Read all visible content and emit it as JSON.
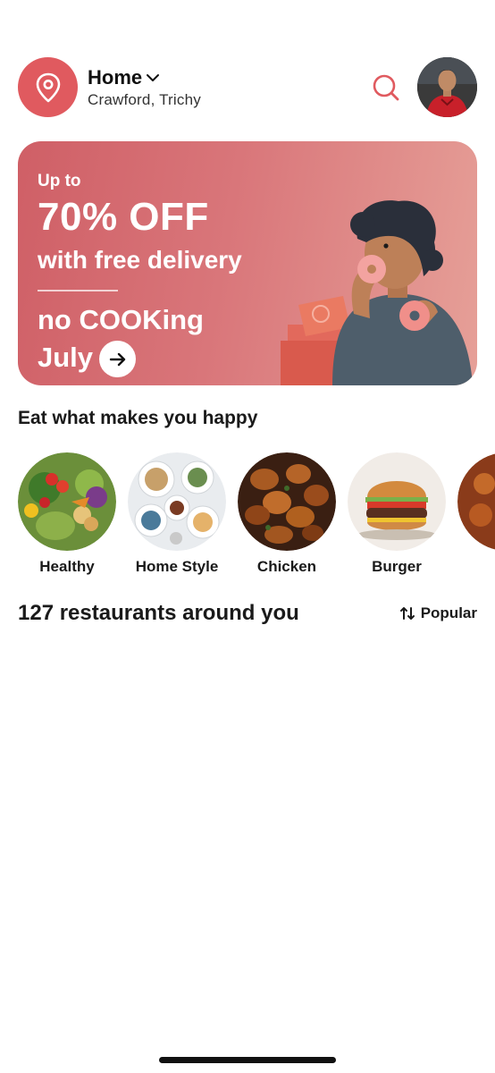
{
  "header": {
    "location_title": "Home",
    "location_subtitle": "Crawford, Trichy",
    "location_icon": "map-pin-icon",
    "search_icon": "search-icon",
    "accent_color": "#e05a5f"
  },
  "banner": {
    "upto": "Up to",
    "headline": "70% OFF",
    "subline": "with free delivery",
    "promo_line1": "no COOKing",
    "promo_line2": "July",
    "arrow_icon": "arrow-right-icon"
  },
  "categories_section": {
    "title": "Eat what makes you happy",
    "items": [
      {
        "label": "Healthy"
      },
      {
        "label": "Home Style"
      },
      {
        "label": "Chicken"
      },
      {
        "label": "Burger"
      }
    ]
  },
  "restaurants": {
    "count_label": "127 restaurants around you",
    "sort_label": "Popular",
    "sort_icon": "sort-arrows-icon"
  }
}
